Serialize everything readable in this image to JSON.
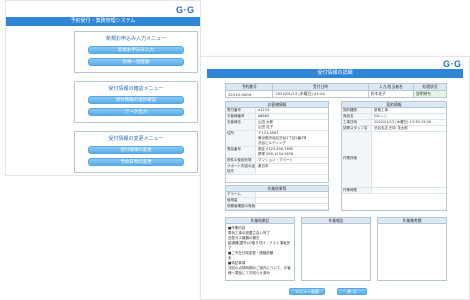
{
  "left": {
    "logo": "G·G",
    "title": "予約受付・業務管理システム",
    "menus": [
      {
        "title": "新規お申込み入力メニュー",
        "buttons": [
          "新規お申込み入力",
          "新規一括登録"
        ]
      },
      {
        "title": "受付情報の確認メニュー",
        "buttons": [
          "受付情報の進捗確認",
          "データ出力"
        ]
      },
      {
        "title": "受付情報の変更メニュー",
        "buttons": [
          "受付情報の変更",
          "予約日時の変更"
        ]
      }
    ]
  },
  "right": {
    "logo": "G·G",
    "title": "受付情報の詳細",
    "header": {
      "columns": [
        "予約番号",
        "受付日時",
        "入力/担当者名",
        "処理状況"
      ],
      "values": [
        "22210-0004",
        "2022/01/13 (木曜日) 22:04",
        "鈴木花子",
        "説明待ち"
      ]
    },
    "basic": {
      "title": "お客様情報",
      "rows": [
        {
          "k": "受付番号",
          "v": "a1234"
        },
        {
          "k": "お客様番号",
          "v": "a8880"
        },
        {
          "k": "お客様名",
          "v": "山田 太郎\n山田 花子"
        },
        {
          "k": "住所",
          "v": "〒123-4567\n東京都渋谷区渋谷1丁目2番3号\n渋谷ビルディング"
        },
        {
          "k": "電話番号",
          "v": "固定 0123-456-7890\n携帯 090-1234-5678"
        },
        {
          "k": "物件の使用形態",
          "v": "マンション・アパート"
        },
        {
          "k": "サポート内容の返信先",
          "v": "東日本"
        }
      ]
    },
    "contract": {
      "title": "契約情報",
      "rows": [
        {
          "k": "契約種別",
          "v": "新築工事"
        },
        {
          "k": "商品名",
          "v": "GG-○○"
        },
        {
          "k": "工事日時",
          "v": "2022/01/13 (木曜日) 13:30-15:00"
        },
        {
          "k": "訪問スタッフ名",
          "v": "渋谷支店 田中 花太郎"
        }
      ],
      "extra_label": "作業詳細",
      "note_label": "作業時間"
    },
    "work": {
      "title": "作業結果等",
      "rows": [
        {
          "k": "アラーム",
          "v": ""
        },
        {
          "k": "使用量",
          "v": ""
        },
        {
          "k": "依頼者確認の有無",
          "v": ""
        }
      ]
    },
    "memos": [
      {
        "title": "作業結果記",
        "body": "■作業内容\n電気工事の設置立会い完了\n旧型ガス機器の撤去\n給湯器(屋外)の取り付け・テスト運転完了\n■ご不在日時変更・連絡依頼\n未\n■特記事項\n次回の点検時期のご案内について、お客様へ電話にてお知らせ済み"
      },
      {
        "title": "作業報告",
        "body": ""
      },
      {
        "title": "作業備考欄",
        "body": ""
      }
    ],
    "buttons": {
      "menu": "メニュー画面",
      "back": "戻 る"
    }
  }
}
